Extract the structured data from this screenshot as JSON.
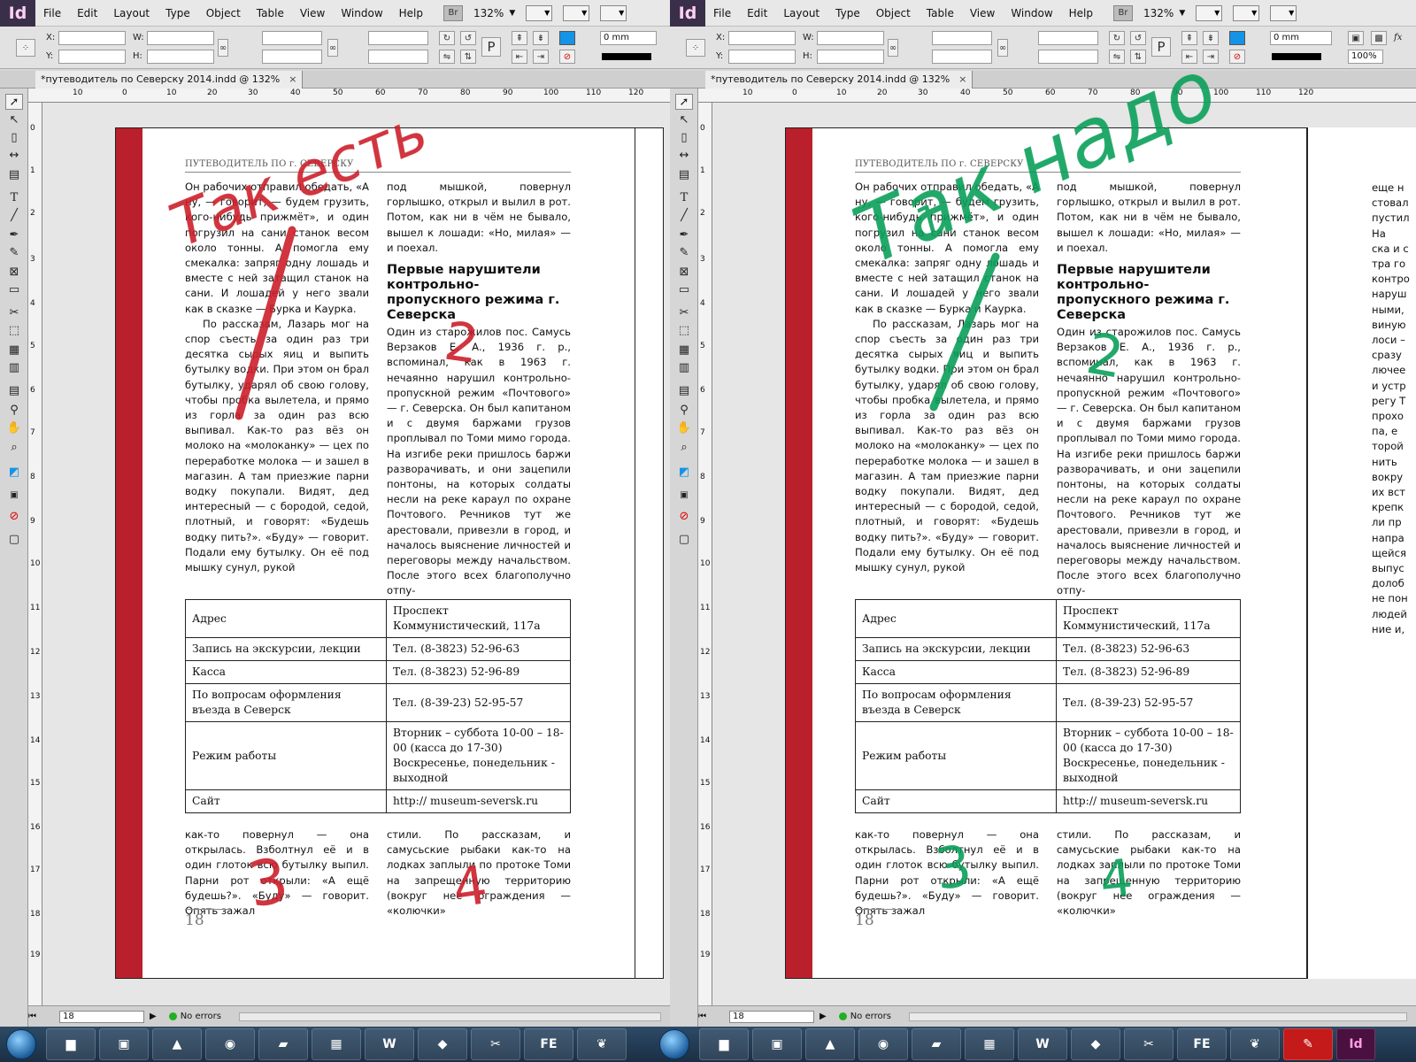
{
  "menu": [
    "File",
    "Edit",
    "Layout",
    "Type",
    "Object",
    "Table",
    "View",
    "Window",
    "Help"
  ],
  "logo": "Id",
  "bridge_label": "Br",
  "zoom": "132%",
  "controls": {
    "x_label": "X:",
    "y_label": "Y:",
    "w_label": "W:",
    "h_label": "H:",
    "stroke_weight": "0 mm",
    "scale_percent": "100%",
    "p_glyph": "P",
    "fx_label": "fx"
  },
  "document_tab": "*путеводитель по Северску 2014.indd @ 132%",
  "tab_close": "×",
  "ruler_top": [
    "10",
    "0",
    "10",
    "20",
    "30",
    "40",
    "50",
    "60",
    "70",
    "80",
    "90",
    "100",
    "110",
    "120"
  ],
  "ruler_left": [
    "0",
    "1",
    "2",
    "3",
    "4",
    "5",
    "6",
    "7",
    "8",
    "9",
    "10",
    "11",
    "12",
    "13",
    "14",
    "15",
    "16",
    "17",
    "18",
    "19"
  ],
  "running_head": "ПУТЕВОДИТЕЛЬ ПО г. СЕВЕРСКУ",
  "col1_p1": "Он рабочих отправил обедать, «А ну, — говорит, — будем грузить, кого-нибудь прижмёт», и один погрузил на сани станок весом около тонны. А помогла ему смекалка: запряг одну лошадь и вместе с ней затащил станок на сани. И лошадей у него звали как в сказке — Бурка и Каурка.",
  "col1_p2": "По рассказам, Лазарь мог на спор съесть за один раз три десятка сырых яиц и выпить бутылку водки. При этом он брал бутылку, ударял об свою голову, чтобы пробка вылетела, и прямо из горла за один раз всю выпивал. Как-то раз вёз он молоко на «молоканку» — цех по переработке молока — и зашел в магазин. А там приезжие парни водку покупали. Видят, дед интересный — с бородой, седой, плотный, и говорят: «Будешь водку пить?». «Буду» — говорит. Подали ему бутылку. Он её под мышку сунул, рукой",
  "col2_p1": "под мышкой, повернул горлышко, открыл и вылил в рот. Потом, как ни в чём не бывало, вышел к лошади: «Но, милая» — и поехал.",
  "col2_subhead": "Первые нарушители контрольно-пропускного режима г. Северска",
  "col2_p2": "Один из старожилов пос. Самусь Верзаков Е. А., 1936 г. р., вспоминал, как в 1963 г. нечаянно нарушил контрольно-пропускной режим «Почтового» — г. Северска. Он был капитаном и с двумя баржами грузов проплывал по Томи мимо города. На изгибе реки пришлось баржи разворачивать, и они зацепили понтоны, на которых солдаты несли на реке караул по охране Почтового. Речников тут же арестовали, привезли в город, и началось выяснение личностей и переговоры между начальством. После этого всех благополучно отпу-",
  "table": [
    [
      "Адрес",
      "Проспект Коммунистический, 117а"
    ],
    [
      "Запись на экскурсии, лекции",
      "Тел. (8-3823) 52-96-63"
    ],
    [
      "Касса",
      "Тел. (8-3823) 52-96-89"
    ],
    [
      "По вопросам оформления въезда в Северск",
      "Тел. (8-39-23) 52-95-57"
    ],
    [
      "Режим работы",
      "Вторник – суббота 10-00 – 18-00 (касса до 17-30) Воскресенье, понедельник - выходной"
    ],
    [
      "Сайт",
      "http:// museum-seversk.ru"
    ]
  ],
  "col1_p3": "как-то повернул — она открылась. Взболтнул её и в один глоток всю бутылку выпил. Парни рот открыли: «А ещё будешь?». «Буду» — говорит. Опять зажал",
  "col2_p3": "стили. По рассказам, и самусьские рыбаки как-то на лодках заплыли по протоке Томи на запрещенную территорию (вокруг нее ограждения — «колючки»",
  "folio": "18",
  "next_page_lines": [
    "еще н",
    "стовал",
    "пустил",
    "На",
    "ска и с",
    "тра го",
    "контро",
    "наруш",
    "ными,",
    "виную",
    "лоси –",
    "сразу",
    "лючее",
    "и устр",
    "регу Т",
    "прохо",
    "па, е",
    "торой",
    "нить",
    "вокру",
    "их вст",
    "крепк",
    "ли пр",
    "напра",
    "щейся",
    "выпус",
    "долоб",
    "не пон",
    "людей",
    "ние и,"
  ],
  "status": {
    "page": "18",
    "errors": "No errors"
  },
  "annotations": {
    "left": "Так есть",
    "right": "Так надо",
    "numbers": [
      "1",
      "2",
      "3",
      "4"
    ],
    "left_color": "#cc1f2a",
    "right_color": "#0aa05a"
  },
  "taskbar_labels": [
    "W",
    "FE",
    "Id"
  ]
}
